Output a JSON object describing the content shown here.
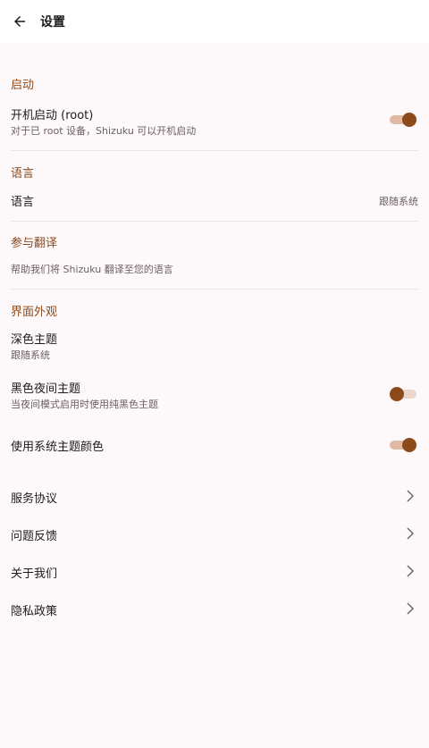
{
  "header": {
    "title": "设置",
    "back_icon": "arrow-back-icon"
  },
  "colors": {
    "accent": "#8c4a1b",
    "section": "#8e4a1b",
    "background": "#fdf8fa"
  },
  "startup": {
    "header": "启动",
    "boot": {
      "title": "开机启动 (root)",
      "summary": "对于已 root 设备，Shizuku 可以开机启动",
      "enabled": true
    }
  },
  "language": {
    "header": "语言",
    "item": {
      "title": "语言",
      "value": "跟随系统"
    }
  },
  "translate": {
    "header": "参与翻译",
    "summary": "帮助我们将 Shizuku 翻译至您的语言"
  },
  "appearance": {
    "header": "界面外观",
    "dark_theme": {
      "title": "深色主题",
      "summary": "跟随系统"
    },
    "black_night": {
      "title": "黑色夜间主题",
      "summary": "当夜间模式启用时使用纯黑色主题",
      "enabled": false
    },
    "system_color": {
      "title": "使用系统主题颜色",
      "enabled": true
    }
  },
  "links": [
    {
      "label": "服务协议",
      "icon": "chevron-right-icon"
    },
    {
      "label": "问题反馈",
      "icon": "chevron-right-icon"
    },
    {
      "label": "关于我们",
      "icon": "chevron-right-icon"
    },
    {
      "label": "隐私政策",
      "icon": "chevron-right-icon"
    }
  ]
}
